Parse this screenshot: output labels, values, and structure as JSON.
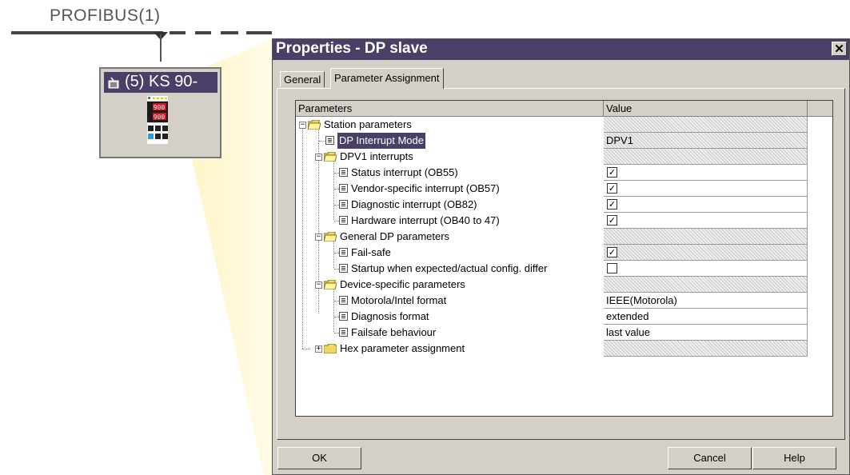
{
  "network": {
    "bus_label": "PROFIBUS(1)",
    "slave_label": "(5) KS 90-",
    "device_display_top": "900",
    "device_display_bottom": "900"
  },
  "dialog": {
    "title": "Properties - DP slave",
    "close_glyph": "✕",
    "tabs": [
      {
        "label": "General",
        "active": false
      },
      {
        "label": "Parameter Assignment",
        "active": true
      }
    ],
    "grid": {
      "columns": [
        "Parameters",
        "Value"
      ],
      "rows": [
        {
          "label": "Station parameters",
          "value": "",
          "kind": "group"
        },
        {
          "label": "DP Interrupt Mode",
          "value": "DPV1",
          "kind": "param",
          "selected": true
        },
        {
          "label": "DPV1 interrupts",
          "value": "",
          "kind": "group"
        },
        {
          "label": "Status interrupt (OB55)",
          "value": "✓",
          "kind": "check"
        },
        {
          "label": "Vendor-specific interrupt (OB57)",
          "value": "✓",
          "kind": "check"
        },
        {
          "label": "Diagnostic interrupt (OB82)",
          "value": "✓",
          "kind": "check"
        },
        {
          "label": "Hardware interrupt (OB40 to 47)",
          "value": "✓",
          "kind": "check"
        },
        {
          "label": "General DP parameters",
          "value": "",
          "kind": "group"
        },
        {
          "label": "Fail-safe",
          "value": "✓",
          "kind": "check"
        },
        {
          "label": "Startup when expected/actual config. differ",
          "value": "",
          "kind": "check"
        },
        {
          "label": "Device-specific parameters",
          "value": "",
          "kind": "group"
        },
        {
          "label": "Motorola/Intel format",
          "value": "IEEE(Motorola)",
          "kind": "param"
        },
        {
          "label": "Diagnosis format",
          "value": "extended",
          "kind": "param"
        },
        {
          "label": "Failsafe behaviour",
          "value": "last value",
          "kind": "param"
        },
        {
          "label": "Hex parameter assignment",
          "value": "",
          "kind": "group"
        }
      ]
    },
    "buttons": {
      "ok": "OK",
      "cancel": "Cancel",
      "help": "Help"
    }
  },
  "icons": {
    "expand_minus": "−",
    "expand_plus": "+"
  },
  "colors": {
    "titlebar": "#4a3f66",
    "dialog_bg": "#d4d0c8",
    "beam": "#fff6cc"
  }
}
